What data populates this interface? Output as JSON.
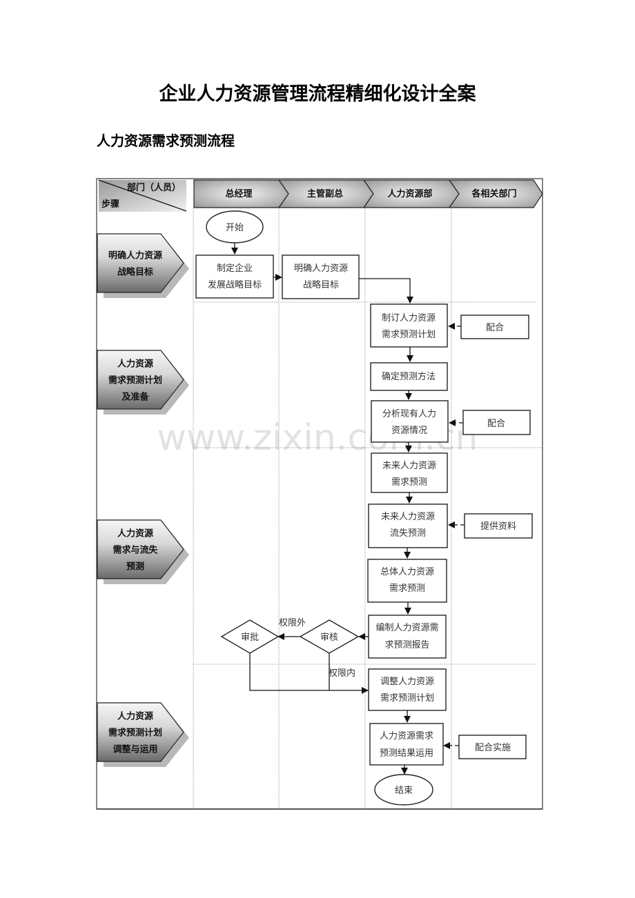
{
  "document": {
    "title": "企业人力资源管理流程精细化设计全案",
    "section_title": "人力资源需求预测流程",
    "watermark": "www.zixin.com.cn"
  },
  "header": {
    "corner_top": "部门（人员）",
    "corner_bottom": "步骤",
    "lanes": [
      "总经理",
      "主管副总",
      "人力资源部",
      "各相关部门"
    ]
  },
  "stages": [
    {
      "lines": [
        "明确人力资源",
        "战略目标"
      ]
    },
    {
      "lines": [
        "人力资源",
        "需求预测计划",
        "及准备"
      ]
    },
    {
      "lines": [
        "人力资源",
        "需求与流失",
        "预测"
      ]
    },
    {
      "lines": [
        "人力资源",
        "需求预测计划",
        "调整与运用"
      ]
    }
  ],
  "nodes": {
    "start": "开始",
    "set_strategy": [
      "制定企业",
      "发展战略目标"
    ],
    "clarify_hr_goal": [
      "明确人力资源",
      "战略目标"
    ],
    "make_plan": [
      "制订人力资源",
      "需求预测计划"
    ],
    "cooperate_1": "配合",
    "method": "确定预测方法",
    "analyze": [
      "分析现有人力",
      "资源情况"
    ],
    "cooperate_2": "配合",
    "future_demand": [
      "未来人力资源",
      "需求预测"
    ],
    "future_loss": [
      "未来人力资源",
      "流失预测"
    ],
    "provide_info": "提供资料",
    "total_demand": [
      "总体人力资源",
      "需求预测"
    ],
    "report": [
      "编制人力资源需",
      "求预测报告"
    ],
    "review": "审核",
    "approve": "审批",
    "outside_authority": "权限外",
    "within_authority": "权限内",
    "adjust": [
      "调整人力资源",
      "需求预测计划"
    ],
    "apply": [
      "人力资源需求",
      "预测结果运用"
    ],
    "cooperate_impl": "配合实施",
    "end": "结束"
  },
  "colors": {
    "header_dark": "#8c8c8c",
    "header_light": "#f2f2f2",
    "stage_dark": "#6e6e6e",
    "stage_light": "#f0f0f0",
    "shadow": "#b8b8b8"
  }
}
